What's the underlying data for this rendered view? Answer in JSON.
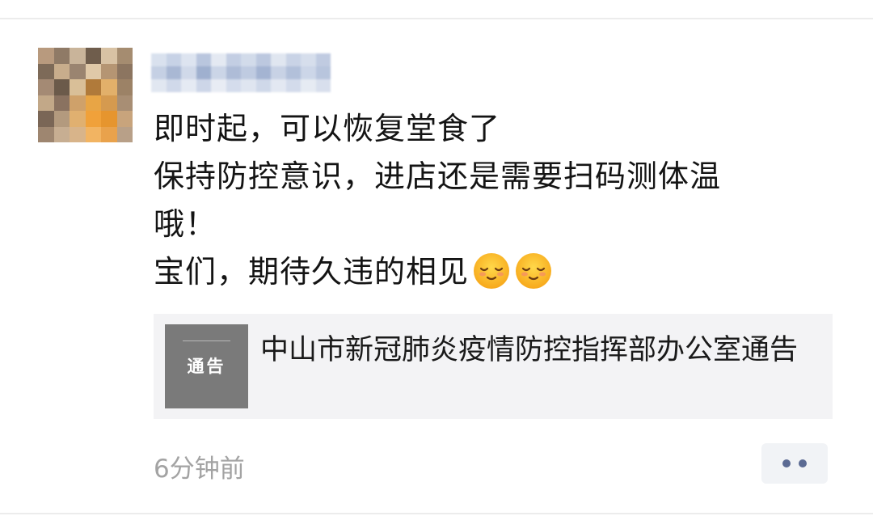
{
  "post": {
    "author_name": "",
    "lines": [
      "即时起，可以恢复堂食了",
      "保持防控意识，进店还是需要扫码测体温",
      "哦！",
      "宝们，期待久违的相见"
    ],
    "emojis": [
      "smiling-face-icon",
      "smiling-face-icon"
    ]
  },
  "link_card": {
    "thumbnail_label": "通告",
    "title": "中山市新冠肺炎疫情防控指挥部办公室通告"
  },
  "footer": {
    "timestamp": "6分钟前",
    "more_icon": "more-dots-icon"
  },
  "colors": {
    "more_dots": "#5b6a93",
    "timestamp": "#a3a3a3",
    "card_background": "#f3f3f5",
    "thumbnail_background": "#7a7a7a"
  }
}
